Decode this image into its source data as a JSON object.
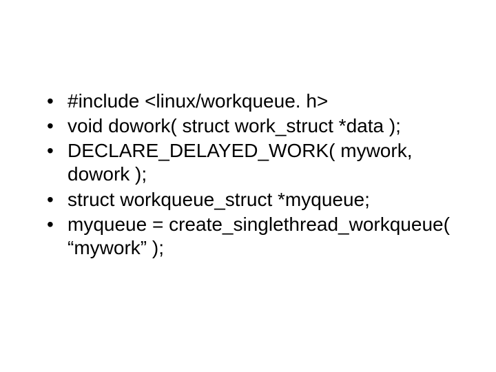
{
  "slide": {
    "bullets": [
      "#include <linux/workqueue. h>",
      "void dowork( struct work_struct *data );",
      "DECLARE_DELAYED_WORK( mywork, dowork );",
      "struct workqueue_struct *myqueue;",
      "myqueue = create_singlethread_workqueue( “mywork” );"
    ]
  }
}
